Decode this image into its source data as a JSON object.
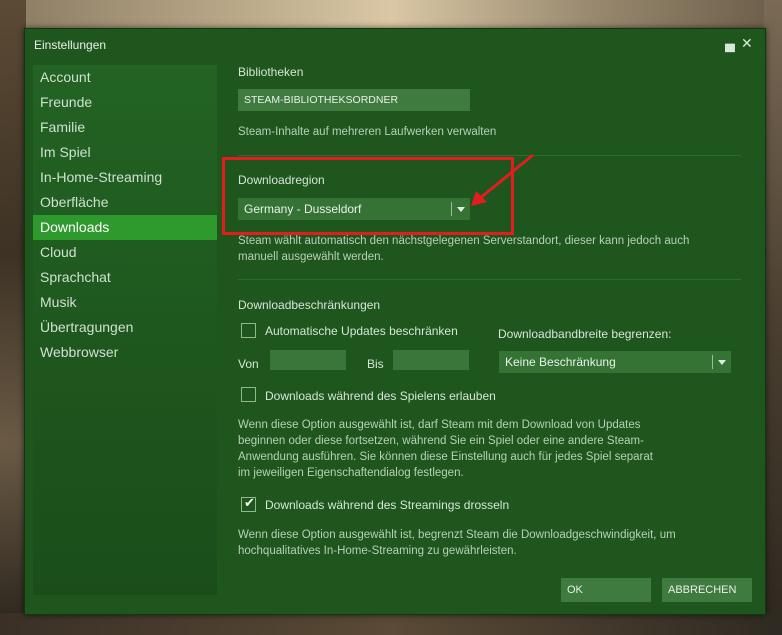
{
  "window": {
    "title": "Einstellungen",
    "minimize_glyph": "▄",
    "close_glyph": "✕"
  },
  "sidebar": {
    "items": [
      {
        "label": "Account"
      },
      {
        "label": "Freunde"
      },
      {
        "label": "Familie"
      },
      {
        "label": "Im Spiel"
      },
      {
        "label": "In-Home-Streaming"
      },
      {
        "label": "Oberfläche"
      },
      {
        "label": "Downloads"
      },
      {
        "label": "Cloud"
      },
      {
        "label": "Sprachchat"
      },
      {
        "label": "Musik"
      },
      {
        "label": "Übertragungen"
      },
      {
        "label": "Webbrowser"
      }
    ],
    "active_index": 6
  },
  "libraries": {
    "heading": "Bibliotheken",
    "button_label": "STEAM-BIBLIOTHEKSORDNER",
    "hint": "Steam-Inhalte auf mehreren Laufwerken verwalten"
  },
  "download_region": {
    "heading": "Downloadregion",
    "selected": "Germany - Dusseldorf",
    "hint": "Steam wählt automatisch den nächstgelegenen Serverstandort, dieser kann jedoch auch manuell ausgewählt werden."
  },
  "restrictions": {
    "heading": "Downloadbeschränkungen",
    "auto_updates_label": "Automatische Updates beschränken",
    "auto_updates_checked": false,
    "from_label": "Von",
    "to_label": "Bis",
    "from_value": "",
    "to_value": "",
    "bandwidth_label": "Downloadbandbreite begrenzen:",
    "bandwidth_selected": "Keine Beschränkung",
    "during_play_label": "Downloads während des Spielens erlauben",
    "during_play_checked": false,
    "during_play_hint": "Wenn diese Option ausgewählt ist, darf Steam mit dem Download von Updates beginnen oder diese fortsetzen, während Sie ein Spiel oder eine andere Steam-Anwendung ausführen. Sie können diese Einstellung auch für jedes Spiel separat im jeweiligen Eigenschaftendialog festlegen.",
    "throttle_streaming_label": "Downloads während des Streamings drosseln",
    "throttle_streaming_checked": true,
    "throttle_streaming_hint": "Wenn diese Option ausgewählt ist, begrenzt Steam die Downloadgeschwindigkeit, um hochqualitatives In-Home-Streaming zu gewährleisten."
  },
  "footer": {
    "ok_label": "OK",
    "cancel_label": "ABBRECHEN"
  },
  "colors": {
    "annotation": "#e21d1d",
    "active_nav": "#2e9a2e",
    "window_bg": "#1e561e"
  }
}
